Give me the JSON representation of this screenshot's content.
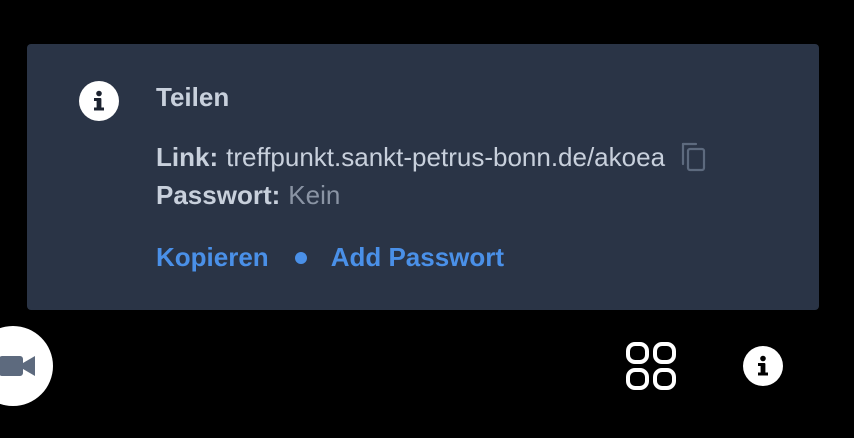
{
  "share_dialog": {
    "title": "Teilen",
    "link_label": "Link:",
    "link_value": "treffpunkt.sankt-petrus-bonn.de/akoea",
    "password_label": "Passwort:",
    "password_value": "Kein",
    "copy_action": "Kopieren",
    "add_password_action": "Add Passwort",
    "info_icon": "info-icon",
    "copy_icon": "copy-icon"
  },
  "toolbar": {
    "camera_icon": "camera-icon",
    "tile_view_icon": "tile-view-icon",
    "info_icon": "info-icon"
  },
  "colors": {
    "background": "#000000",
    "panel": "#2a3446",
    "text": "#c8d0dc",
    "muted_text": "#8a94a4",
    "accent": "#4a90e8",
    "icon_bg": "#ffffff"
  }
}
